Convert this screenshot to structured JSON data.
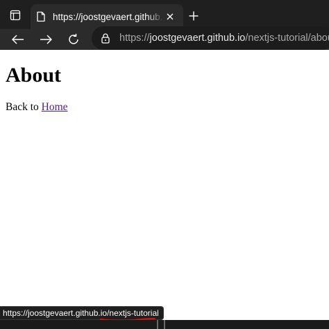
{
  "browser": {
    "tab": {
      "title": "https://joostgevaert.github.io/nextjs-tutorial/about",
      "icon": "page-icon"
    },
    "address_bar": {
      "prefix": "https://",
      "domain": "joostgevaert.github.io",
      "path": "/nextjs-tutorial/about"
    }
  },
  "page": {
    "heading": "About",
    "back_text": "Back to ",
    "home_link": "Home"
  },
  "status_bar": {
    "url": "https://joostgevaert.github.io/nextjs-tutorial",
    "annotation_color": "#e01010"
  },
  "colors": {
    "tabstrip": "#1f1f1f",
    "toolbar": "#2b2b2b",
    "link": "#551a8b"
  }
}
